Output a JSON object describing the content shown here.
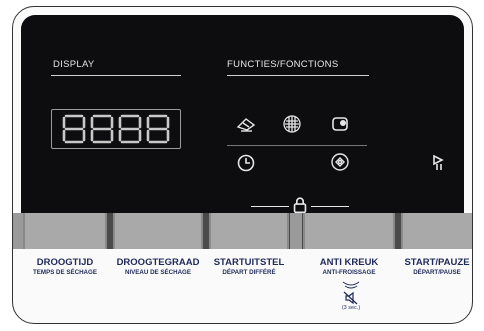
{
  "labels": {
    "display": "DISPLAY",
    "functions": "FUNCTIES/FONCTIONS",
    "seconds": "(3 sec.)"
  },
  "digits": "8888",
  "icons": [
    "iron-icon",
    "drum-icon",
    "rack-icon",
    "timer-icon",
    "extra-icon",
    "play-pause-icon",
    "lock-icon",
    "mute-icon"
  ],
  "buttons": [
    {
      "label": "DROOGTIJD",
      "sublabel": "TEMPS DE SÉCHAGE"
    },
    {
      "label": "DROOGTEGRAAD",
      "sublabel": "NIVEAU DE SÉCHAGE"
    },
    {
      "label": "STARTUITSTEL",
      "sublabel": "DÉPART DIFFÉRÉ"
    },
    {
      "label": "ANTI KREUK",
      "sublabel": "ANTI-FROISSAGE"
    },
    {
      "label": "START/PAUZE",
      "sublabel": "DÉPART/PAUSE"
    }
  ],
  "colors": {
    "panel": "#0d0d0f",
    "caption": "#1f2a5a",
    "button": "#a9a9a9"
  }
}
